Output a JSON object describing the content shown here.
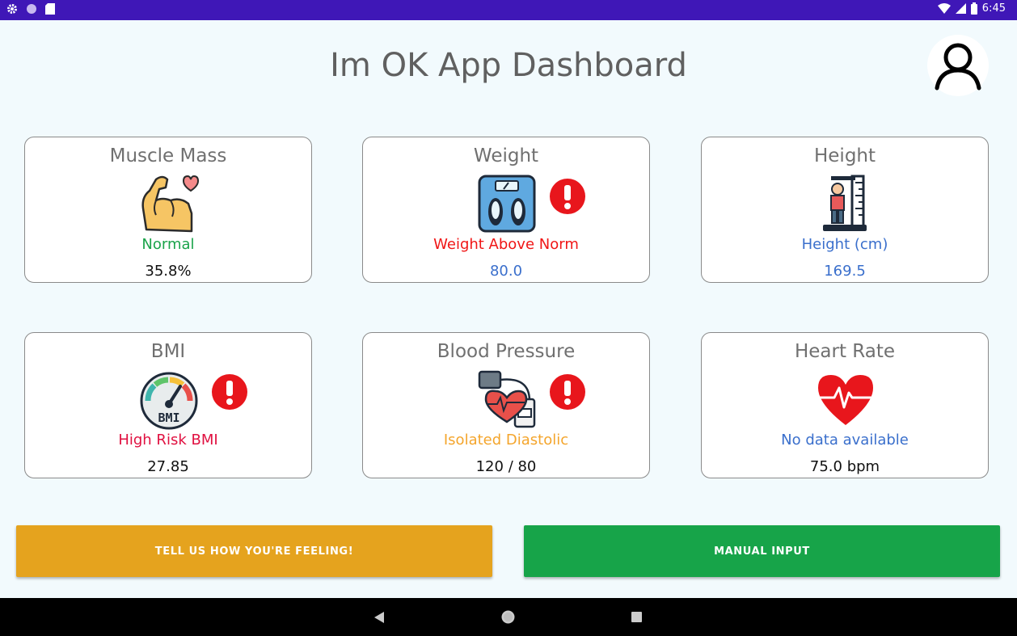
{
  "status_bar": {
    "time": "6:45"
  },
  "header": {
    "title": "Im OK App Dashboard"
  },
  "cards": [
    {
      "title": "Muscle Mass",
      "status": "Normal",
      "value": "35.8%",
      "status_color": "#1aa34a",
      "value_color": "#111111",
      "alert": false
    },
    {
      "title": "Weight",
      "status": "Weight Above Norm",
      "value": "80.0",
      "status_color": "#f01616",
      "value_color": "#3a6fcc",
      "alert": true
    },
    {
      "title": "Height",
      "status": "Height (cm)",
      "value": "169.5",
      "status_color": "#3a6fcc",
      "value_color": "#3a6fcc",
      "alert": false
    },
    {
      "title": "BMI",
      "status": "High Risk BMI",
      "value": "27.85",
      "status_color": "#e01040",
      "value_color": "#111111",
      "alert": true
    },
    {
      "title": "Blood Pressure",
      "status": "Isolated Diastolic",
      "value": "120 / 80",
      "status_color": "#f4a52c",
      "value_color": "#111111",
      "alert": true
    },
    {
      "title": "Heart Rate",
      "status": "No data available",
      "value": "75.0 bpm",
      "status_color": "#3a6fcc",
      "value_color": "#111111",
      "alert": false
    }
  ],
  "buttons": {
    "feeling": "TELL US HOW YOU'RE FEELING!",
    "manual": "MANUAL INPUT"
  },
  "colors": {
    "status_bar": "#3f17b7",
    "feeling_button": "#e5a31e",
    "manual_button": "#17a449",
    "alert": "#e8161c"
  },
  "icons": {
    "muscle": "flexed-arm-icon",
    "weight": "scale-icon",
    "height": "height-ruler-icon",
    "bmi": "bmi-gauge-icon",
    "blood_pressure": "blood-pressure-monitor-icon",
    "heart_rate": "heartbeat-icon"
  }
}
